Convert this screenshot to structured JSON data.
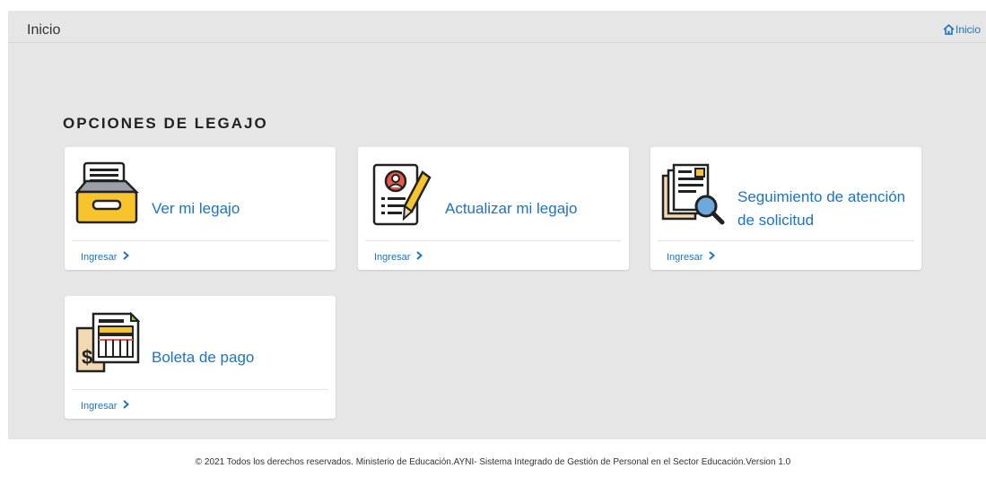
{
  "header": {
    "title": "Inicio",
    "breadcrumb_label": "Inicio"
  },
  "section": {
    "title": "OPCIONES DE LEGAJO"
  },
  "cards": [
    {
      "title": "Ver mi legajo",
      "action": "Ingresar",
      "icon": "inbox-tray-icon"
    },
    {
      "title": "Actualizar mi legajo",
      "action": "Ingresar",
      "icon": "profile-edit-icon"
    },
    {
      "title": "Seguimiento de atención de solicitud",
      "action": "Ingresar",
      "icon": "document-search-icon"
    },
    {
      "title": "Boleta de pago",
      "action": "Ingresar",
      "icon": "payslip-icon"
    }
  ],
  "footer": {
    "text": "© 2021 Todos los derechos reservados. Ministerio de Educación.AYNI- Sistema Integrado de Gestión de Personal en el Sector Educación.Version 1.0"
  },
  "colors": {
    "accent": "#1e73be",
    "background": "#e6e6e6",
    "card": "#ffffff"
  }
}
